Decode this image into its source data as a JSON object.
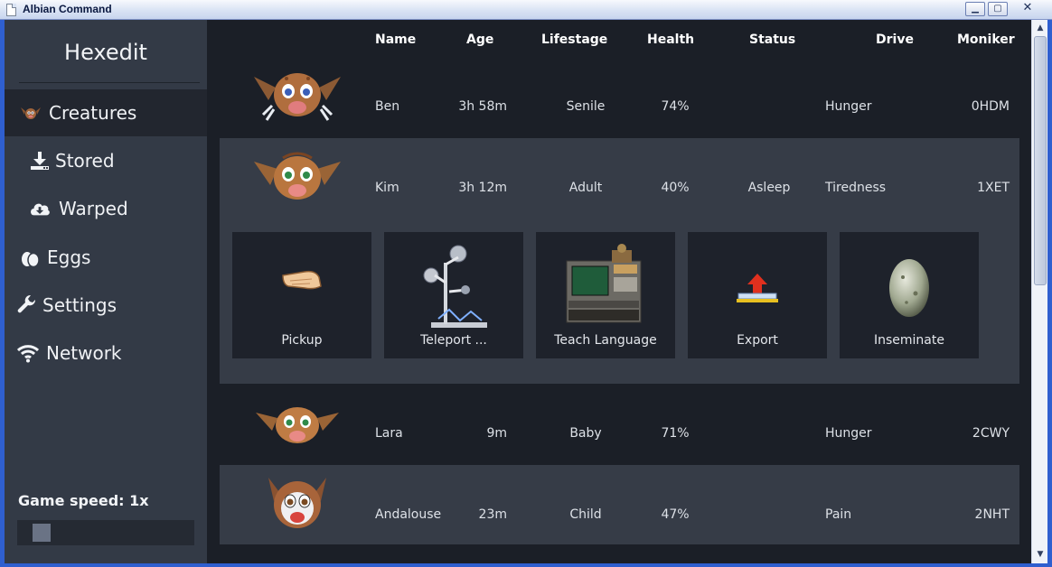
{
  "window": {
    "title": "Albian Command",
    "min_glyph": "▁",
    "max_glyph": "▢",
    "close_glyph": "✕"
  },
  "sidebar": {
    "brand": "Hexedit",
    "items": [
      {
        "label": "Creatures",
        "icon": "creature-icon",
        "active": true
      },
      {
        "label": "Stored",
        "icon": "download-icon",
        "active": false
      },
      {
        "label": "Warped",
        "icon": "cloud-download-icon",
        "active": false
      },
      {
        "label": "Eggs",
        "icon": "eggs-icon",
        "active": false
      },
      {
        "label": "Settings",
        "icon": "wrench-icon",
        "active": false
      },
      {
        "label": "Network",
        "icon": "wifi-icon",
        "active": false
      }
    ],
    "game_speed": {
      "label": "Game speed: 1x",
      "level": 0.08
    }
  },
  "table": {
    "headers": {
      "name": "Name",
      "age": "Age",
      "lifestage": "Lifestage",
      "health": "Health",
      "status": "Status",
      "drive": "Drive",
      "moniker": "Moniker"
    },
    "rows": [
      {
        "name": "Ben",
        "age": "3h 58m",
        "lifestage": "Senile",
        "health": "74%",
        "status": "",
        "drive": "Hunger",
        "moniker": "0HDM",
        "avatar": "norn-elder-avatar"
      },
      {
        "name": "Kim",
        "age": "3h 12m",
        "lifestage": "Adult",
        "health": "40%",
        "status": "Asleep",
        "drive": "Tiredness",
        "moniker": "1XET",
        "avatar": "norn-adult-avatar"
      },
      {
        "name": "Lara",
        "age": "9m",
        "lifestage": "Baby",
        "health": "71%",
        "status": "",
        "drive": "Hunger",
        "moniker": "2CWY",
        "avatar": "norn-baby-avatar"
      },
      {
        "name": "Andalouse",
        "age": "23m",
        "lifestage": "Child",
        "health": "47%",
        "status": "",
        "drive": "Pain",
        "moniker": "2NHT",
        "avatar": "norn-child-avatar"
      }
    ]
  },
  "actions": [
    {
      "label": "Pickup",
      "icon": "hand-icon"
    },
    {
      "label": "Teleport ...",
      "icon": "teleporter-icon"
    },
    {
      "label": "Teach Language",
      "icon": "learning-computer-icon"
    },
    {
      "label": "Export",
      "icon": "export-pad-icon"
    },
    {
      "label": "Inseminate",
      "icon": "egg-icon"
    }
  ],
  "colors": {
    "sidebar_bg": "#333a46",
    "sidebar_active": "#22262f",
    "main_bg": "#1b1f27",
    "row_light": "#363c47",
    "action_tile": "#1e222b"
  }
}
